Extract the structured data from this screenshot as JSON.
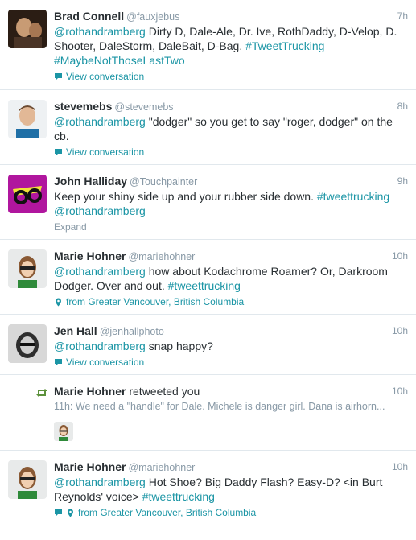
{
  "tweets": [
    {
      "name": "Brad Connell",
      "handle": "@fauxjebus",
      "time": "7h",
      "mention": "@rothandramberg",
      "text": " Dirty D, Dale-Ale, Dr. Ive, RothDaddy, D-Velop, D. Shooter, DaleStorm, DaleBait, D-Bag. ",
      "tags": "#TweetTrucking #MaybeNotThoseLastTwo",
      "action": "View conversation"
    },
    {
      "name": "stevemebs",
      "handle": "@stevemebs",
      "time": "8h",
      "mention": "@rothandramberg",
      "text": " \"dodger\" so you get to say \"roger, dodger\" on the cb.",
      "action": "View conversation"
    },
    {
      "name": "John Halliday",
      "handle": "@Touchpainter",
      "time": "9h",
      "text": "Keep your shiny side up and your rubber side down. ",
      "tags": "#tweettrucking",
      "mention": "@rothandramberg",
      "action": "Expand"
    },
    {
      "name": "Marie Hohner",
      "handle": "@mariehohner",
      "time": "10h",
      "mention": "@rothandramberg",
      "text": " how about Kodachrome Roamer? Or, Darkroom Dodger. Over and out. ",
      "tags": "#tweettrucking",
      "action": "from Greater Vancouver, British Columbia"
    },
    {
      "name": "Jen Hall",
      "handle": "@jenhallphoto",
      "time": "10h",
      "mention": "@rothandramberg",
      "text": " snap happy?",
      "action": "View conversation"
    },
    {
      "name": "Marie Hohner",
      "suffix": " retweeted you",
      "time": "10h",
      "snippet": "11h: We need a \"handle\" for Dale. Michele is danger girl. Dana is airhorn..."
    },
    {
      "name": "Marie Hohner",
      "handle": "@mariehohner",
      "time": "10h",
      "mention": "@rothandramberg",
      "text": " Hot Shoe? Big Daddy Flash? Easy-D? <in Burt Reynolds' voice> ",
      "tags": "#tweettrucking",
      "action": "from Greater Vancouver, British Columbia"
    }
  ],
  "colors": {
    "link": "#1b95a5",
    "muted": "#8899a6",
    "retweet": "#5c913b"
  }
}
